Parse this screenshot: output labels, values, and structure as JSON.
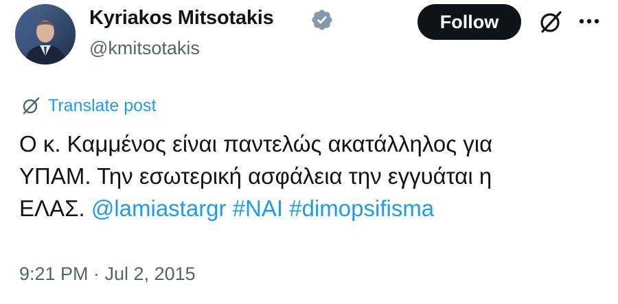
{
  "author": {
    "display_name": "Kyriakos Mitsotakis",
    "handle": "@kmitsotakis",
    "verified": true,
    "avatar_icon": "profile-photo"
  },
  "actions": {
    "follow_label": "Follow",
    "grok_icon": "grok-icon",
    "more_icon": "more-options-icon"
  },
  "translate": {
    "label": "Translate post",
    "icon": "translate-icon"
  },
  "post": {
    "line1": "Ο κ. Καμμένος είναι παντελώς ακατάλληλος για",
    "line2": "ΥΠΑΜ. Την εσωτερική ασφάλεια την εγγυάται η",
    "line3_text": "ΕΛΑΣ. ",
    "mention": "@lamiastargr",
    "hashtag1": "#ΝΑΙ",
    "hashtag2": "#dimopsifisma"
  },
  "meta": {
    "timestamp": "9:21 PM · Jul 2, 2015"
  },
  "colors": {
    "text": "#0f1419",
    "secondary": "#536471",
    "link": "#1d9bf0",
    "verified": "#829aab",
    "button_bg": "#0f1419"
  }
}
